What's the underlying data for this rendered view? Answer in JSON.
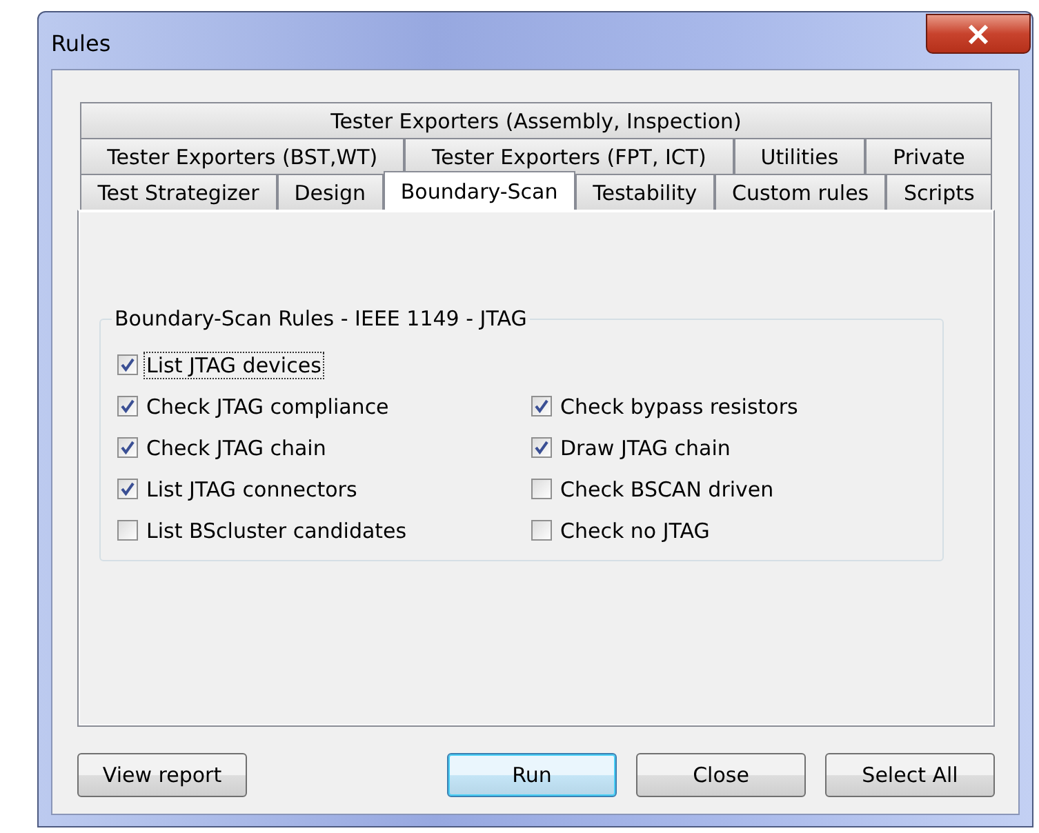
{
  "window": {
    "title": "Rules"
  },
  "tab_rows": [
    [
      {
        "label": "Tester Exporters (Assembly, Inspection)",
        "selected": false
      }
    ],
    [
      {
        "label": "Tester Exporters (BST,WT)",
        "selected": false
      },
      {
        "label": "Tester Exporters (FPT, ICT)",
        "selected": false
      },
      {
        "label": "Utilities",
        "selected": false
      },
      {
        "label": "Private",
        "selected": false
      }
    ],
    [
      {
        "label": "Test Strategizer",
        "selected": false
      },
      {
        "label": "Design",
        "selected": false
      },
      {
        "label": "Boundary-Scan",
        "selected": true
      },
      {
        "label": "Testability",
        "selected": false
      },
      {
        "label": "Custom rules",
        "selected": false
      },
      {
        "label": "Scripts",
        "selected": false
      }
    ]
  ],
  "group": {
    "title": "Boundary-Scan Rules - IEEE 1149 - JTAG",
    "rows": [
      [
        {
          "label": "List JTAG devices",
          "checked": true,
          "focused": true
        }
      ],
      [
        {
          "label": "Check JTAG compliance",
          "checked": true,
          "focused": false
        },
        {
          "label": "Check bypass resistors",
          "checked": true,
          "focused": false
        }
      ],
      [
        {
          "label": "Check JTAG chain",
          "checked": true,
          "focused": false
        },
        {
          "label": "Draw JTAG chain",
          "checked": true,
          "focused": false
        }
      ],
      [
        {
          "label": "List JTAG connectors",
          "checked": true,
          "focused": false
        },
        {
          "label": "Check BSCAN driven",
          "checked": false,
          "focused": false
        }
      ],
      [
        {
          "label": "List BScluster candidates",
          "checked": false,
          "focused": false
        },
        {
          "label": "Check no JTAG",
          "checked": false,
          "focused": false
        }
      ]
    ]
  },
  "buttons": [
    {
      "label": "View report",
      "default": false
    },
    {
      "label": "Run",
      "default": true
    },
    {
      "label": "Close",
      "default": false
    },
    {
      "label": "Select All",
      "default": false
    }
  ]
}
